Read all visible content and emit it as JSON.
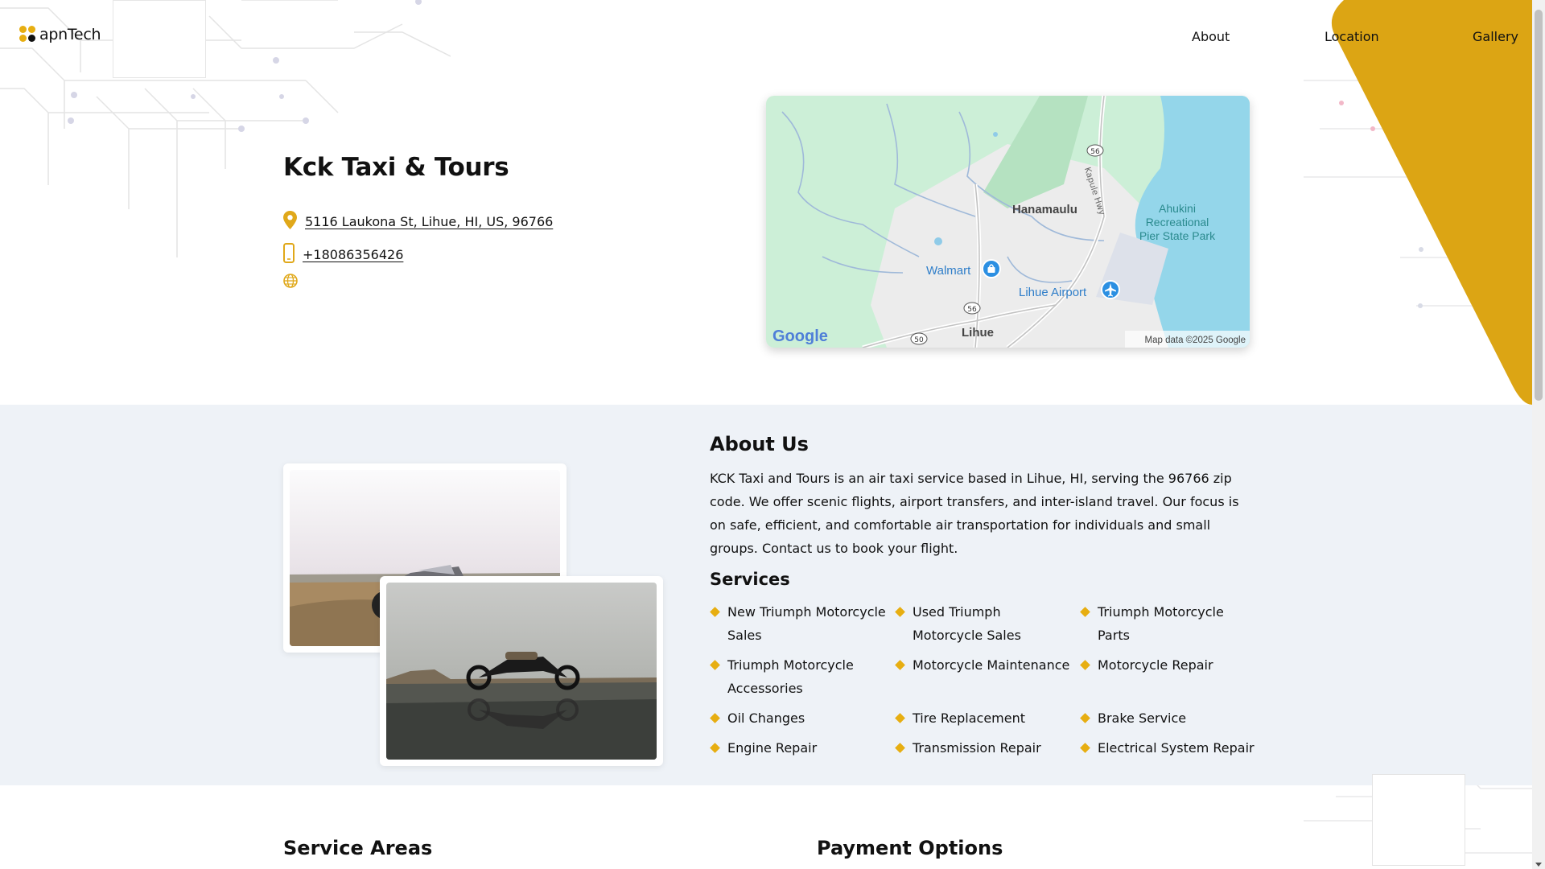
{
  "brand": {
    "name": "apnTech"
  },
  "nav": {
    "about": "About",
    "location": "Location",
    "gallery": "Gallery"
  },
  "business": {
    "name": "Kck Taxi & Tours",
    "address": "5116 Laukona St, Lihue, HI, US, 96766",
    "phone": "+18086356426"
  },
  "map": {
    "labels": {
      "hanamaulu": "Hanamaulu",
      "walmart": "Walmart",
      "airport": "Lihue Airport",
      "lihue": "Lihue",
      "park1": "Ahukini",
      "park2": "Recreational",
      "park3": "Pier State Park",
      "highway": "Kapule Hwy",
      "route56a": "56",
      "route56b": "56",
      "route50": "50",
      "google": "Google",
      "attribution": "Map data ©2025 Google"
    }
  },
  "about": {
    "title": "About Us",
    "text": "KCK Taxi and Tours is an air taxi service based in Lihue, HI, serving the 96766 zip code. We offer scenic flights, airport transfers, and inter-island travel. Our focus is on safe, efficient, and comfortable air transportation for individuals and small groups. Contact us to book your flight."
  },
  "services": {
    "title": "Services",
    "items": [
      "New Triumph Motorcycle Sales",
      "Used Triumph Motorcycle Sales",
      "Triumph Motorcycle Parts",
      "Triumph Motorcycle Accessories",
      "Motorcycle Maintenance",
      "Motorcycle Repair",
      "Oil Changes",
      "Tire Replacement",
      "Brake Service",
      "Engine Repair",
      "Transmission Repair",
      "Electrical System Repair"
    ]
  },
  "sections": {
    "service_areas": "Service Areas",
    "payment_options": "Payment Options"
  },
  "colors": {
    "accent": "#e7ae11",
    "section_bg": "#eef2f7",
    "text": "#111111"
  },
  "icons": {
    "address": "map-pin-icon",
    "phone": "phone-icon",
    "website": "globe-icon",
    "service_bullet": "diamond-bullet-icon",
    "map_walmart": "shopping-bag-icon",
    "map_airport": "airplane-icon"
  }
}
